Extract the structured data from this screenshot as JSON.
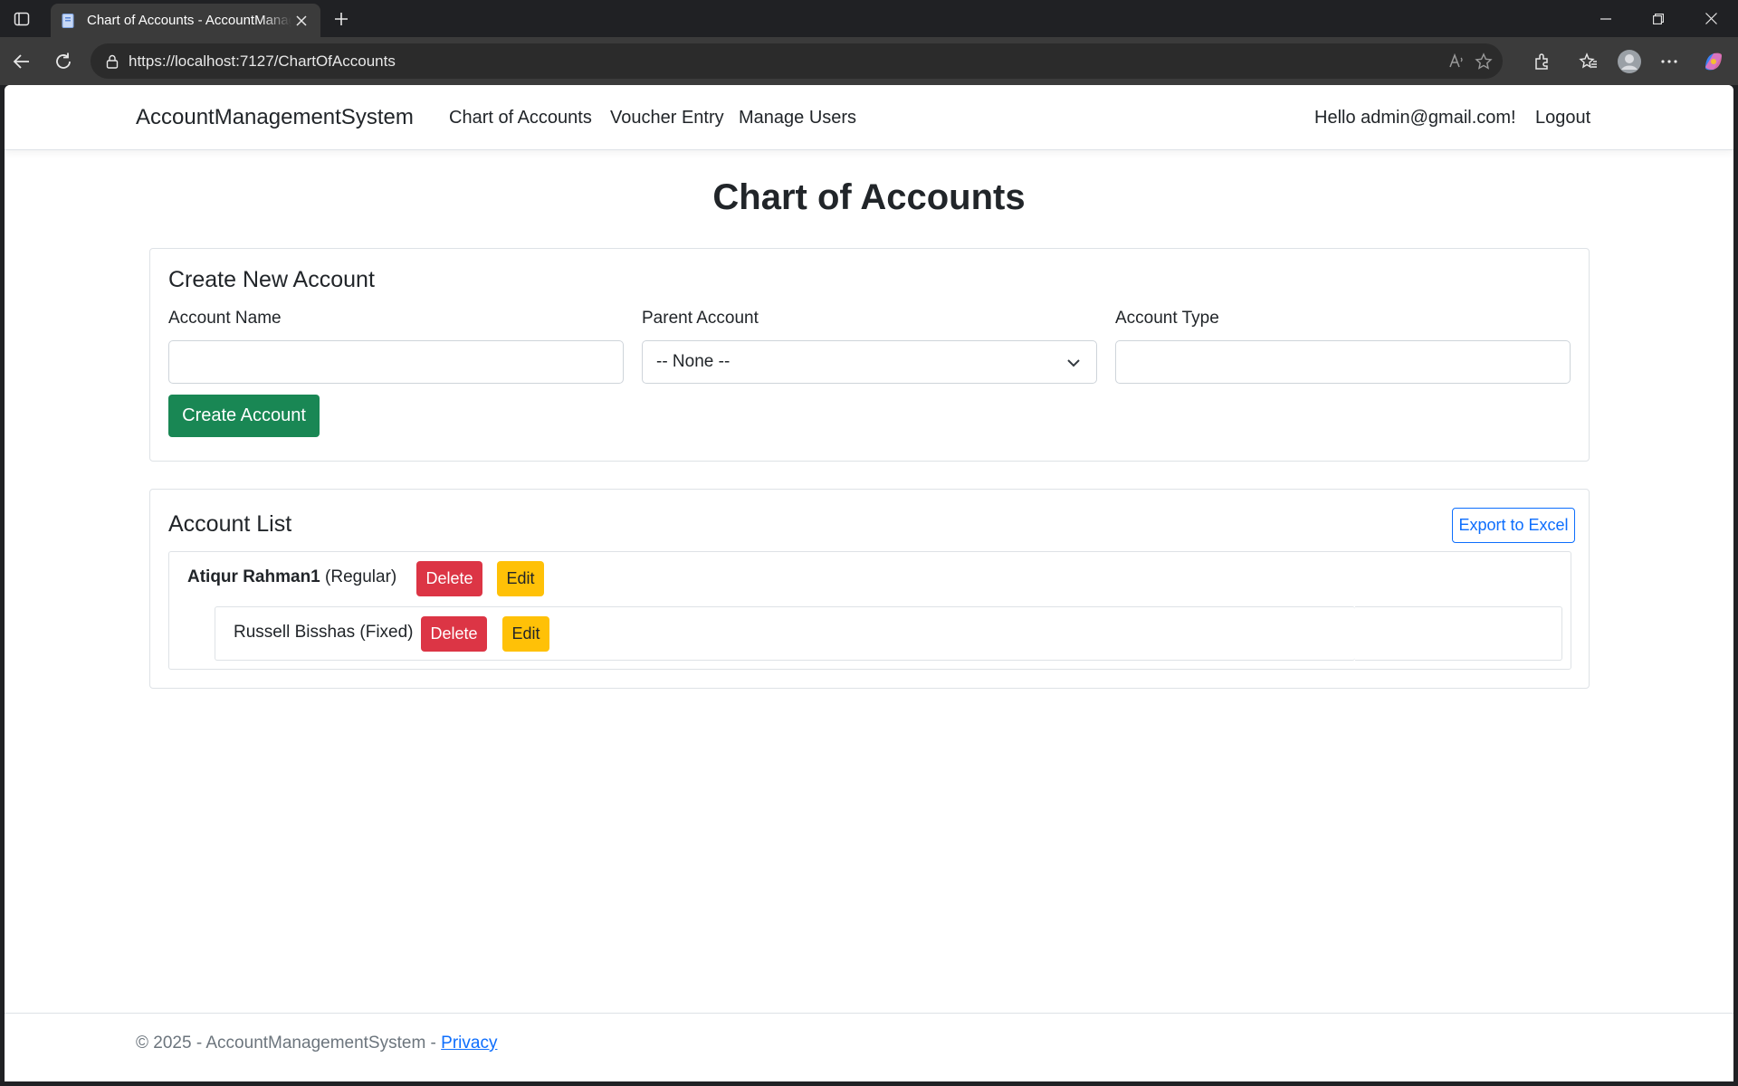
{
  "browser": {
    "tab_title": "Chart of Accounts - AccountManagementSystem",
    "url": "https://localhost:7127/ChartOfAccounts"
  },
  "nav": {
    "brand": "AccountManagementSystem",
    "links": [
      "Chart of Accounts",
      "Voucher Entry",
      "Manage Users"
    ],
    "greeting": "Hello admin@gmail.com!",
    "logout": "Logout"
  },
  "page": {
    "title": "Chart of Accounts"
  },
  "create_form": {
    "title": "Create New Account",
    "account_name_label": "Account Name",
    "account_name_value": "",
    "parent_label": "Parent Account",
    "parent_selected": "-- None --",
    "type_label": "Account Type",
    "type_value": "",
    "submit": "Create Account"
  },
  "account_list": {
    "title": "Account List",
    "export": "Export to Excel",
    "parent": {
      "name": "Atiqur Rahman1",
      "type": "(Regular)",
      "delete": "Delete",
      "edit": "Edit"
    },
    "child": {
      "text": "Russell Bisshas (Fixed)",
      "delete": "Delete",
      "edit": "Edit"
    }
  },
  "footer": {
    "text": "© 2025 - AccountManagementSystem - ",
    "privacy": "Privacy"
  },
  "colors": {
    "primary": "#0d6efd",
    "success": "#198754",
    "danger": "#dc3545",
    "warning": "#ffc107"
  }
}
